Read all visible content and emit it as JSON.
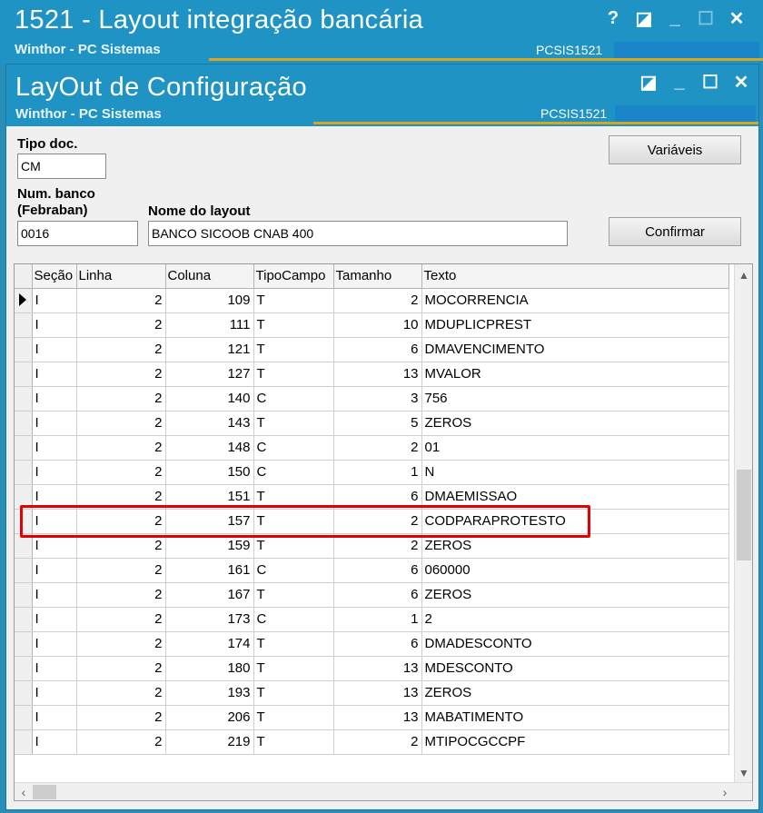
{
  "outer_window": {
    "title": "1521 - Layout integração bancária",
    "subtitle": "Winthor - PC Sistemas",
    "code": "PCSIS1521",
    "buttons": {
      "help": "?",
      "restore": "◪",
      "minimize": "_",
      "maximize": "☐",
      "close": "✕"
    }
  },
  "inner_window": {
    "title": "LayOut de Configuração",
    "subtitle": "Winthor - PC Sistemas",
    "code": "PCSIS1521",
    "buttons": {
      "restore": "◪",
      "minimize": "_",
      "maximize": "☐",
      "close": "✕"
    }
  },
  "form": {
    "tipo_doc_label": "Tipo doc.",
    "tipo_doc_value": "CM",
    "num_banco_label_1": "Num. banco",
    "num_banco_label_2": "(Febraban)",
    "num_banco_value": "0016",
    "nome_layout_label": "Nome do layout",
    "nome_layout_value": "BANCO SICOOB CNAB 400",
    "variaveis_button": "Variáveis",
    "confirmar_button": "Confirmar"
  },
  "grid": {
    "columns": [
      "Seção",
      "Linha",
      "Coluna",
      "TipoCampo",
      "Tamanho",
      "Texto"
    ],
    "rows": [
      [
        "I",
        "2",
        "109",
        "T",
        "2",
        "MOCORRENCIA"
      ],
      [
        "I",
        "2",
        "111",
        "T",
        "10",
        "MDUPLICPREST"
      ],
      [
        "I",
        "2",
        "121",
        "T",
        "6",
        "DMAVENCIMENTO"
      ],
      [
        "I",
        "2",
        "127",
        "T",
        "13",
        "MVALOR"
      ],
      [
        "I",
        "2",
        "140",
        "C",
        "3",
        "756"
      ],
      [
        "I",
        "2",
        "143",
        "T",
        "5",
        "ZEROS"
      ],
      [
        "I",
        "2",
        "148",
        "C",
        "2",
        "01"
      ],
      [
        "I",
        "2",
        "150",
        "C",
        "1",
        "N"
      ],
      [
        "I",
        "2",
        "151",
        "T",
        "6",
        "DMAEMISSAO"
      ],
      [
        "I",
        "2",
        "157",
        "T",
        "2",
        "CODPARAPROTESTO"
      ],
      [
        "I",
        "2",
        "159",
        "T",
        "2",
        "ZEROS"
      ],
      [
        "I",
        "2",
        "161",
        "C",
        "6",
        "060000"
      ],
      [
        "I",
        "2",
        "167",
        "T",
        "6",
        "ZEROS"
      ],
      [
        "I",
        "2",
        "173",
        "C",
        "1",
        "2"
      ],
      [
        "I",
        "2",
        "174",
        "T",
        "6",
        "DMADESCONTO"
      ],
      [
        "I",
        "2",
        "180",
        "T",
        "13",
        "MDESCONTO"
      ],
      [
        "I",
        "2",
        "193",
        "T",
        "13",
        "ZEROS"
      ],
      [
        "I",
        "2",
        "206",
        "T",
        "13",
        "MABATIMENTO"
      ],
      [
        "I",
        "2",
        "219",
        "T",
        "2",
        "MTIPOCGCCPF"
      ]
    ],
    "current_row": 0,
    "highlighted_row": 9
  },
  "colors": {
    "titlebar": "#1f93c4",
    "accent_line": "#d9a521",
    "highlight": "#e30000"
  }
}
